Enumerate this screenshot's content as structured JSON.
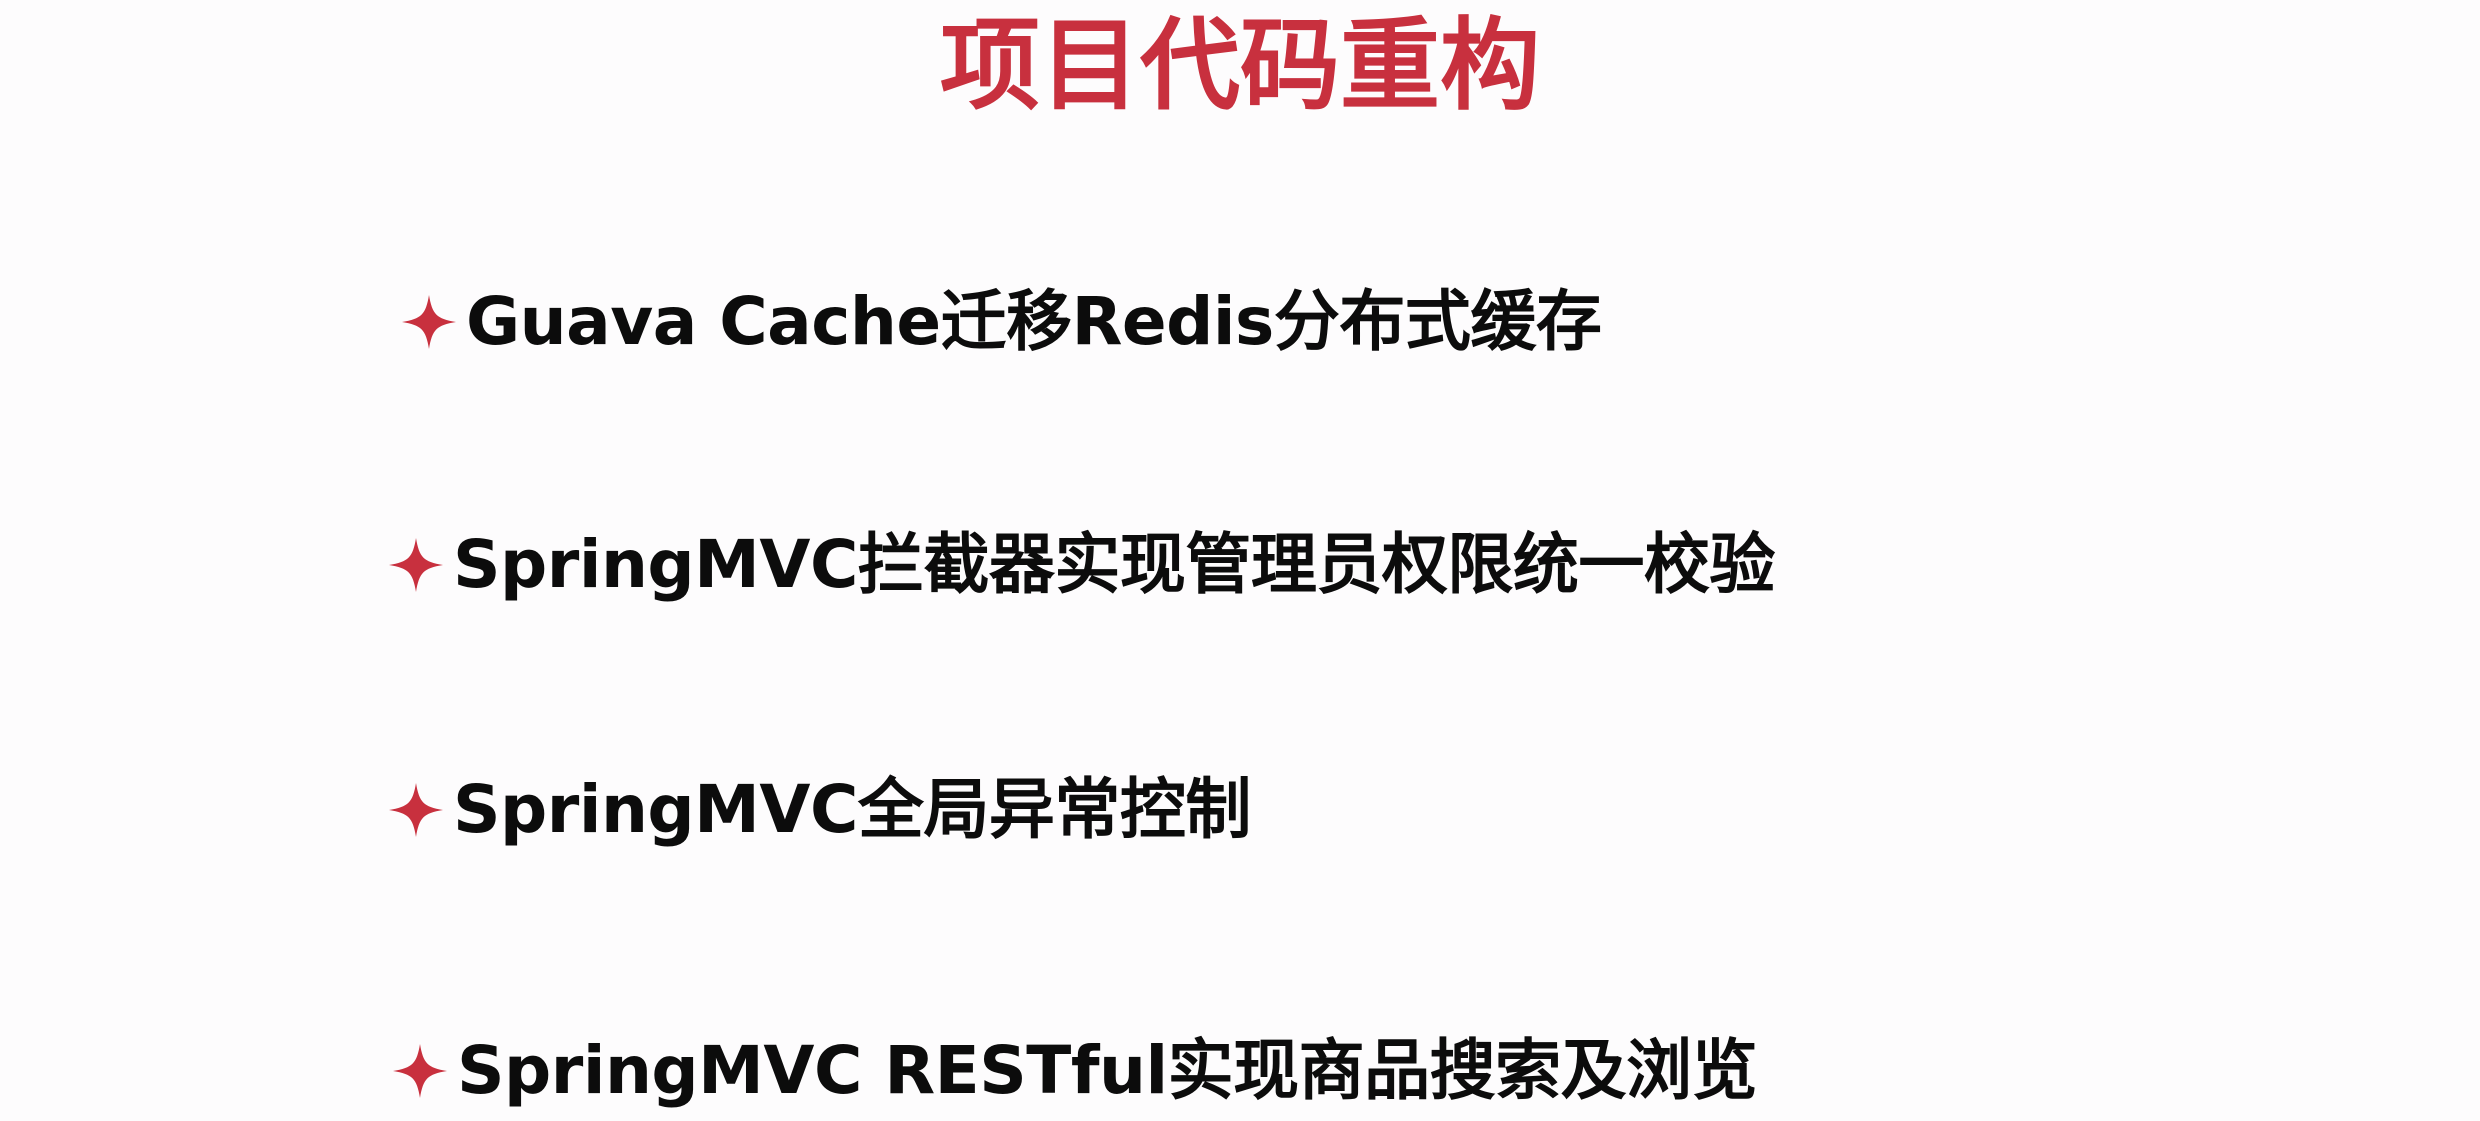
{
  "title": "项目代码重构",
  "colors": {
    "title": "#c8303e",
    "bullet_star": "#c8303e",
    "text": "#0c0c0c",
    "background": "#fdfcfd"
  },
  "bullet_icon": "four-point-star-icon",
  "items": [
    {
      "text": "Guava Cache迁移Redis分布式缓存"
    },
    {
      "text": "SpringMVC拦截器实现管理员权限统一校验"
    },
    {
      "text": "SpringMVC全局异常控制"
    },
    {
      "text": "SpringMVC RESTful实现商品搜索及浏览"
    }
  ]
}
